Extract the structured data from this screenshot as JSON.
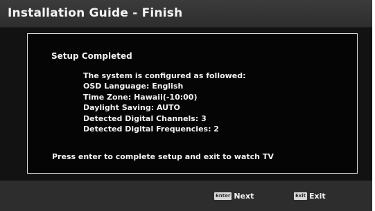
{
  "header": {
    "title": "Installation Guide - Finish"
  },
  "panel": {
    "heading": "Setup Completed",
    "lines": [
      "The system is configured as followed:",
      "OSD Language:  English",
      "Time Zone:  Hawaii(-10:00)",
      "Daylight Saving:  AUTO",
      "Detected Digital Channels:  3",
      "Detected Digital Frequencies:  2"
    ],
    "instruction": "Press enter to complete setup and exit to watch TV"
  },
  "footer": {
    "next": {
      "keycap": "Enter",
      "label": "Next"
    },
    "exit": {
      "keycap": "Exit",
      "label": "Exit"
    }
  },
  "colors": {
    "background": "#0a0a0a",
    "titlebar": "#333333",
    "bottombar": "#2d2d2d",
    "panel_border": "#d8d8d8",
    "text": "#f2f2f2"
  }
}
